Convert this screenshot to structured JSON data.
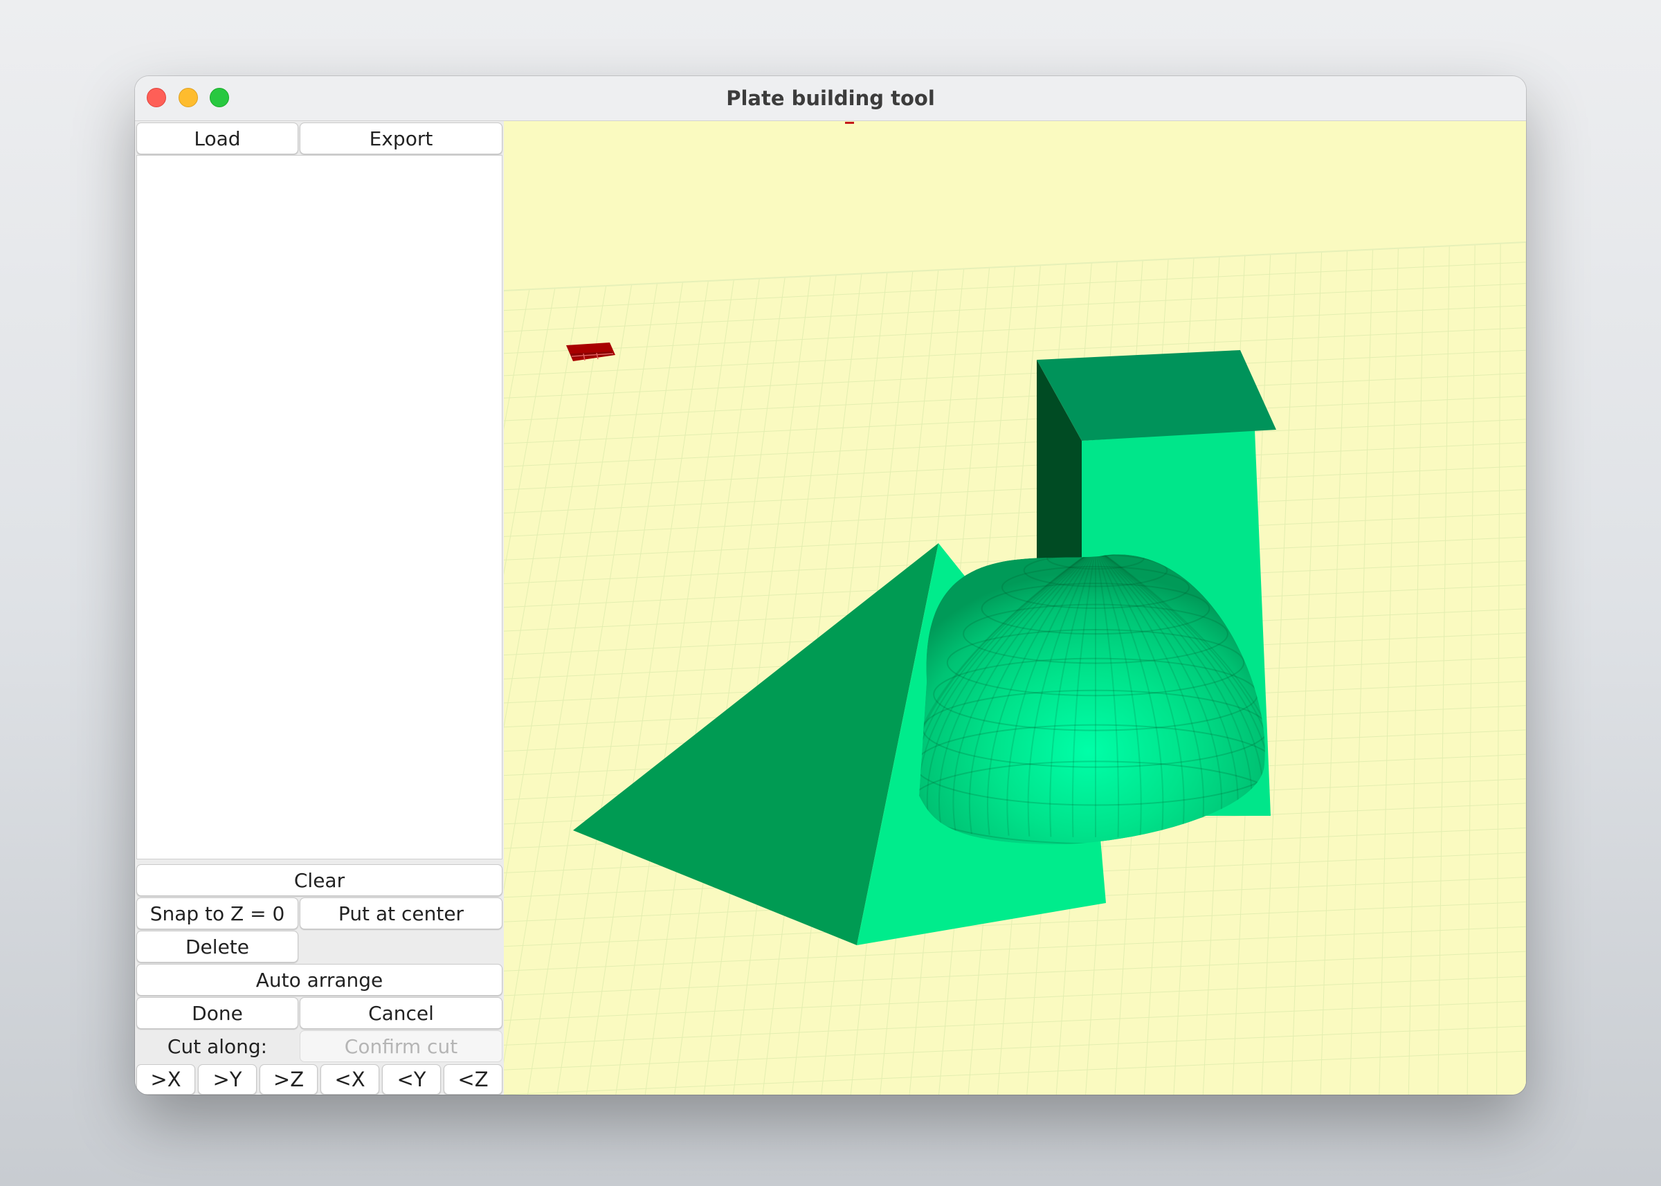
{
  "window": {
    "title": "Plate building tool"
  },
  "toolbar": {
    "load_label": "Load",
    "export_label": "Export"
  },
  "object_list": {
    "items": []
  },
  "actions": {
    "clear_label": "Clear",
    "snap_label": "Snap to Z = 0",
    "center_label": "Put at center",
    "delete_label": "Delete",
    "auto_arrange_label": "Auto arrange",
    "done_label": "Done",
    "cancel_label": "Cancel"
  },
  "cut": {
    "label": "Cut along:",
    "confirm_label": "Confirm cut",
    "confirm_enabled": false,
    "axes": [
      ">X",
      ">Y",
      ">Z",
      "<X",
      "<Y",
      "<Z"
    ]
  },
  "scene": {
    "background": "#fafac0",
    "grid_color": "#e3eeb0",
    "objects": [
      "pyramid",
      "box",
      "hemisphere"
    ],
    "object_color": "#00e68a",
    "axis_marker_color": "#c00000"
  }
}
